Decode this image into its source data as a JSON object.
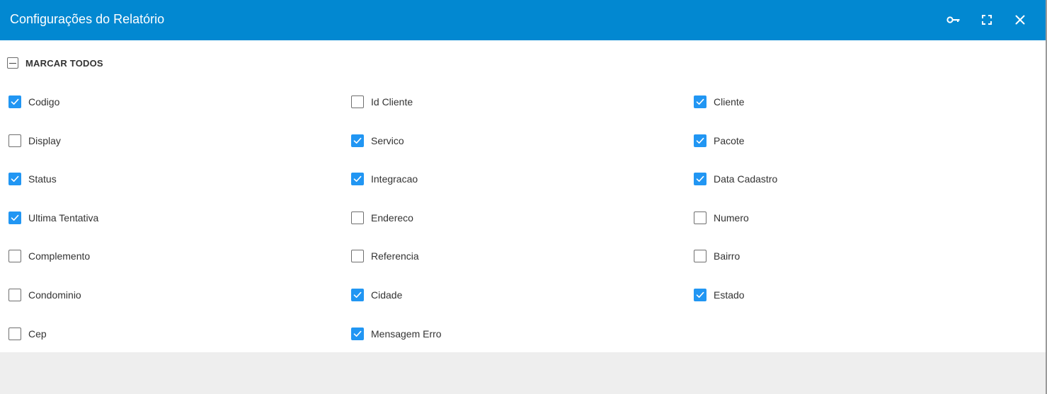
{
  "dialog": {
    "title": "Configurações do Relatório"
  },
  "toolbar": {
    "icons": [
      "key-icon",
      "fullscreen-icon",
      "close-icon"
    ]
  },
  "select_all": {
    "label": "MARCAR TODOS",
    "state": "indeterminate"
  },
  "fields": [
    {
      "label": "Codigo",
      "checked": true
    },
    {
      "label": "Id Cliente",
      "checked": false
    },
    {
      "label": "Cliente",
      "checked": true
    },
    {
      "label": "Display",
      "checked": false
    },
    {
      "label": "Servico",
      "checked": true
    },
    {
      "label": "Pacote",
      "checked": true
    },
    {
      "label": "Status",
      "checked": true
    },
    {
      "label": "Integracao",
      "checked": true
    },
    {
      "label": "Data Cadastro",
      "checked": true
    },
    {
      "label": "Ultima Tentativa",
      "checked": true
    },
    {
      "label": "Endereco",
      "checked": false
    },
    {
      "label": "Numero",
      "checked": false
    },
    {
      "label": "Complemento",
      "checked": false
    },
    {
      "label": "Referencia",
      "checked": false
    },
    {
      "label": "Bairro",
      "checked": false
    },
    {
      "label": "Condominio",
      "checked": false
    },
    {
      "label": "Cidade",
      "checked": true
    },
    {
      "label": "Estado",
      "checked": true
    },
    {
      "label": "Cep",
      "checked": false
    },
    {
      "label": "Mensagem Erro",
      "checked": true
    }
  ],
  "colors": {
    "header": "#0288d1",
    "checkbox_checked": "#2196f3",
    "footer": "#eeeeee"
  }
}
